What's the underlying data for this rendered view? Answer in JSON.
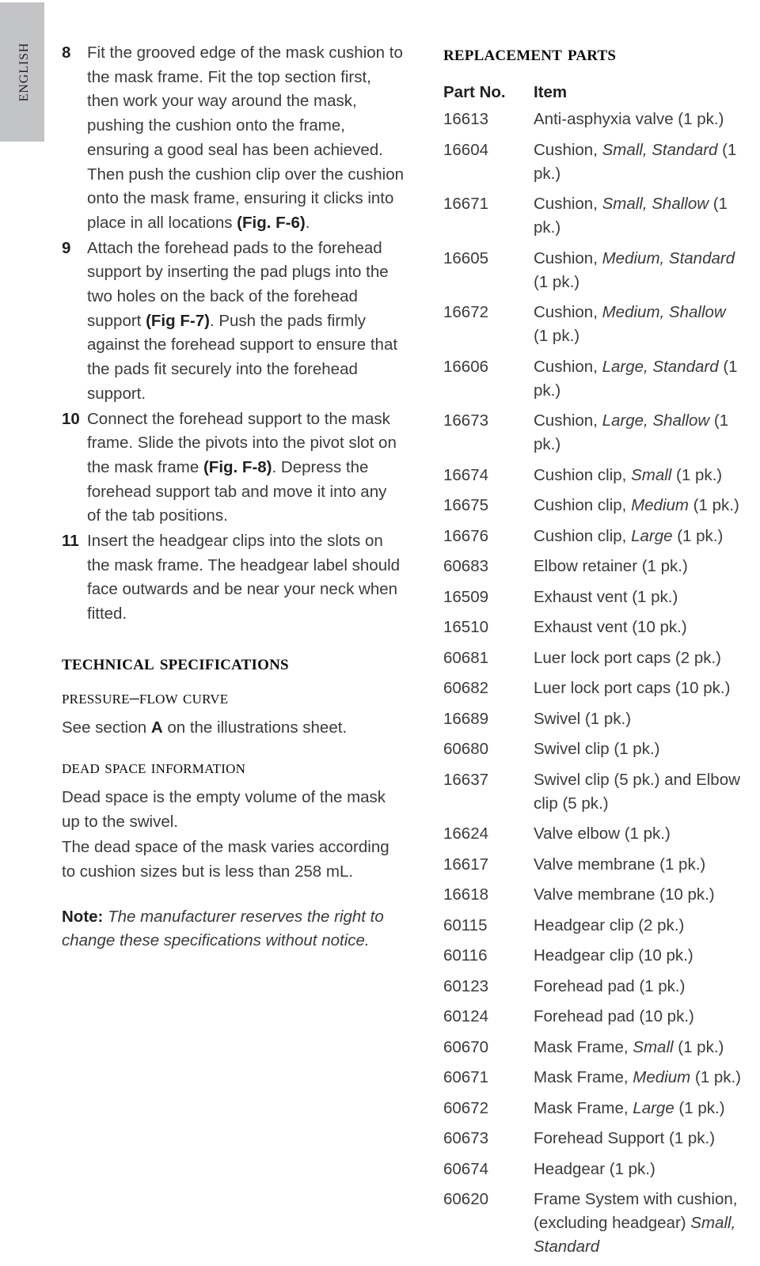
{
  "sidebar": {
    "language_label": "English"
  },
  "left_column": {
    "steps": [
      {
        "number": "8",
        "paragraphs": [
          "Fit the grooved edge of the mask cushion to the mask frame. Fit the top section first, then work your way around the mask, pushing the cushion onto the frame, ensuring a good seal has been achieved.",
          "Then push the cushion clip over the cushion onto the mask frame, ensuring it clicks into place in all locations (Fig. F-6)."
        ]
      },
      {
        "number": "9",
        "paragraphs": [
          "Attach the forehead pads to the forehead support by inserting the pad plugs into the two holes on the back of the forehead support (Fig F-7). Push the pads firmly against the forehead support to ensure that the pads fit securely into the forehead support."
        ]
      },
      {
        "number": "10",
        "paragraphs": [
          "Connect the forehead support to the mask frame. Slide the pivots into the pivot slot on the mask frame (Fig. F-8). Depress the forehead support tab and move it into any of the tab positions."
        ]
      },
      {
        "number": "11",
        "paragraphs": [
          "Insert the headgear clips into the slots on the mask frame. The headgear label should face outwards and be near your neck when fitted."
        ]
      }
    ],
    "technical_specifications_heading": "Technical Specifications",
    "pressure_flow_curve_heading": "Pressure–Flow Curve",
    "pressure_flow_curve_text_before": "See section ",
    "pressure_flow_curve_section_letter": "A",
    "pressure_flow_curve_text_after": " on the illustrations sheet.",
    "dead_space_heading": "Dead Space Information",
    "dead_space_paragraph_1": "Dead space is the empty volume of the mask up to the swivel.",
    "dead_space_paragraph_2": "The dead space of the mask varies according to cushion sizes but is less than 258 mL.",
    "note_label": "Note:",
    "note_text": " The manufacturer reserves the right to change these specifications without notice."
  },
  "right_column": {
    "title": "Replacement Parts",
    "columns": {
      "part_no": "Part No.",
      "item": "Item"
    },
    "rows": [
      {
        "part_no": "16613",
        "item_lines": [
          [
            {
              "t": "Anti-asphyxia valve (1 pk.)",
              "i": false
            }
          ]
        ]
      },
      {
        "part_no": "16604",
        "item_lines": [
          [
            {
              "t": "Cushion, ",
              "i": false
            },
            {
              "t": "Small, Standard",
              "i": true
            },
            {
              "t": " (1 pk.)",
              "i": false
            }
          ]
        ]
      },
      {
        "part_no": "16671",
        "item_lines": [
          [
            {
              "t": "Cushion, ",
              "i": false
            },
            {
              "t": "Small, Shallow",
              "i": true
            },
            {
              "t": " (1 pk.)",
              "i": false
            }
          ]
        ]
      },
      {
        "part_no": "16605",
        "item_lines": [
          [
            {
              "t": "Cushion, ",
              "i": false
            },
            {
              "t": "Medium, Standard",
              "i": true
            }
          ],
          [
            {
              "t": "(1 pk.)",
              "i": false
            }
          ]
        ]
      },
      {
        "part_no": "16672",
        "item_lines": [
          [
            {
              "t": "Cushion, ",
              "i": false
            },
            {
              "t": "Medium, Shallow",
              "i": true
            }
          ],
          [
            {
              "t": "(1 pk.)",
              "i": false
            }
          ]
        ]
      },
      {
        "part_no": "16606",
        "item_lines": [
          [
            {
              "t": "Cushion, ",
              "i": false
            },
            {
              "t": "Large, Standard",
              "i": true
            },
            {
              "t": " (1 pk.)",
              "i": false
            }
          ]
        ]
      },
      {
        "part_no": "16673",
        "item_lines": [
          [
            {
              "t": "Cushion, ",
              "i": false
            },
            {
              "t": "Large, Shallow",
              "i": true
            },
            {
              "t": " (1 pk.)",
              "i": false
            }
          ]
        ]
      },
      {
        "part_no": "16674",
        "item_lines": [
          [
            {
              "t": "Cushion clip, ",
              "i": false
            },
            {
              "t": "Small",
              "i": true
            },
            {
              "t": " (1 pk.)",
              "i": false
            }
          ]
        ]
      },
      {
        "part_no": "16675",
        "item_lines": [
          [
            {
              "t": "Cushion clip, ",
              "i": false
            },
            {
              "t": "Medium",
              "i": true
            },
            {
              "t": " (1 pk.)",
              "i": false
            }
          ]
        ]
      },
      {
        "part_no": "16676",
        "item_lines": [
          [
            {
              "t": "Cushion clip, ",
              "i": false
            },
            {
              "t": "Large",
              "i": true
            },
            {
              "t": " (1 pk.)",
              "i": false
            }
          ]
        ]
      },
      {
        "part_no": "60683",
        "item_lines": [
          [
            {
              "t": "Elbow retainer (1 pk.)",
              "i": false
            }
          ]
        ]
      },
      {
        "part_no": "16509",
        "item_lines": [
          [
            {
              "t": "Exhaust vent (1 pk.)",
              "i": false
            }
          ]
        ]
      },
      {
        "part_no": "16510",
        "item_lines": [
          [
            {
              "t": "Exhaust vent (10 pk.)",
              "i": false
            }
          ]
        ]
      },
      {
        "part_no": "60681",
        "item_lines": [
          [
            {
              "t": "Luer lock port caps (2 pk.)",
              "i": false
            }
          ]
        ]
      },
      {
        "part_no": "60682",
        "item_lines": [
          [
            {
              "t": "Luer lock port caps (10 pk.)",
              "i": false
            }
          ]
        ]
      },
      {
        "part_no": "16689",
        "item_lines": [
          [
            {
              "t": "Swivel (1 pk.)",
              "i": false
            }
          ]
        ]
      },
      {
        "part_no": "60680",
        "item_lines": [
          [
            {
              "t": "Swivel clip (1 pk.)",
              "i": false
            }
          ]
        ]
      },
      {
        "part_no": "16637",
        "item_lines": [
          [
            {
              "t": "Swivel clip (5 pk.) and Elbow",
              "i": false
            }
          ],
          [
            {
              "t": "clip (5 pk.)",
              "i": false
            }
          ]
        ]
      },
      {
        "part_no": "16624",
        "item_lines": [
          [
            {
              "t": "Valve elbow (1 pk.)",
              "i": false
            }
          ]
        ]
      },
      {
        "part_no": "16617",
        "item_lines": [
          [
            {
              "t": "Valve membrane (1 pk.)",
              "i": false
            }
          ]
        ]
      },
      {
        "part_no": "16618",
        "item_lines": [
          [
            {
              "t": "Valve membrane (10 pk.)",
              "i": false
            }
          ]
        ]
      },
      {
        "part_no": "60115",
        "item_lines": [
          [
            {
              "t": "Headgear clip (2 pk.)",
              "i": false
            }
          ]
        ]
      },
      {
        "part_no": "60116",
        "item_lines": [
          [
            {
              "t": "Headgear clip (10 pk.)",
              "i": false
            }
          ]
        ]
      },
      {
        "part_no": "60123",
        "item_lines": [
          [
            {
              "t": "Forehead pad (1 pk.)",
              "i": false
            }
          ]
        ]
      },
      {
        "part_no": "60124",
        "item_lines": [
          [
            {
              "t": "Forehead pad (10 pk.)",
              "i": false
            }
          ]
        ]
      },
      {
        "part_no": "60670",
        "item_lines": [
          [
            {
              "t": "Mask Frame, ",
              "i": false
            },
            {
              "t": "Small",
              "i": true
            },
            {
              "t": " (1 pk.)",
              "i": false
            }
          ]
        ]
      },
      {
        "part_no": "60671",
        "item_lines": [
          [
            {
              "t": "Mask Frame, ",
              "i": false
            },
            {
              "t": "Medium",
              "i": true
            },
            {
              "t": " (1 pk.)",
              "i": false
            }
          ]
        ]
      },
      {
        "part_no": "60672",
        "item_lines": [
          [
            {
              "t": "Mask Frame, ",
              "i": false
            },
            {
              "t": "Large",
              "i": true
            },
            {
              "t": " (1 pk.)",
              "i": false
            }
          ]
        ]
      },
      {
        "part_no": "60673",
        "item_lines": [
          [
            {
              "t": "Forehead Support (1 pk.)",
              "i": false
            }
          ]
        ]
      },
      {
        "part_no": "60674",
        "item_lines": [
          [
            {
              "t": "Headgear (1 pk.)",
              "i": false
            }
          ]
        ]
      },
      {
        "part_no": "60620",
        "item_lines": [
          [
            {
              "t": "Frame System with cushion,",
              "i": false
            }
          ],
          [
            {
              "t": "(excluding headgear) ",
              "i": false
            },
            {
              "t": "Small,",
              "i": true
            }
          ],
          [
            {
              "t": "Standard",
              "i": true
            }
          ]
        ]
      }
    ]
  },
  "colors": {
    "tab_background": "#c3c4c6",
    "body_text": "#3b3b3d",
    "heading_text": "#0d0d0d"
  }
}
